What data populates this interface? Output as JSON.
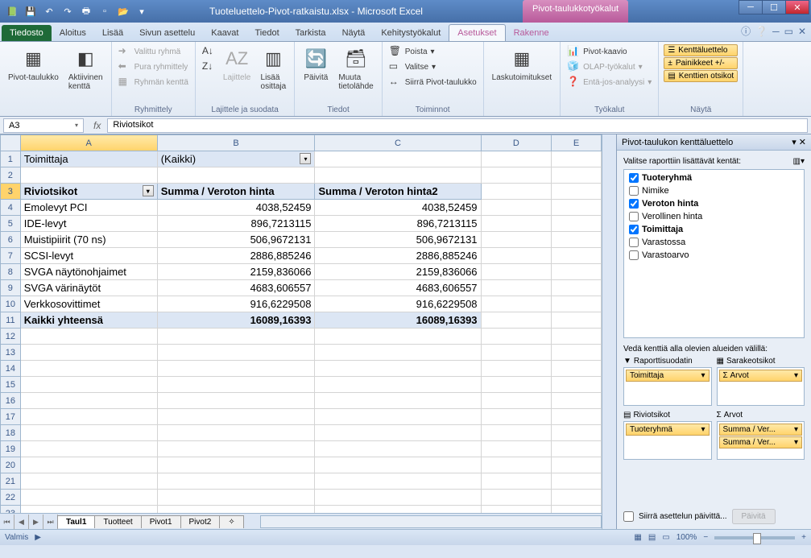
{
  "app": {
    "title": "Tuoteluettelo-Pivot-ratkaistu.xlsx - Microsoft Excel",
    "contextTools": "Pivot-taulukkotyökalut"
  },
  "tabs": {
    "file": "Tiedosto",
    "list": [
      "Aloitus",
      "Lisää",
      "Sivun asettelu",
      "Kaavat",
      "Tiedot",
      "Tarkista",
      "Näytä",
      "Kehitystyökalut"
    ],
    "pivot": [
      "Asetukset",
      "Rakenne"
    ],
    "activeIndex": 0
  },
  "ribbon": {
    "g1": {
      "btn1": "Pivot-taulukko",
      "btn2": "Aktiivinen\nkenttä"
    },
    "g2": {
      "label": "Ryhmittely",
      "i1": "Valittu ryhmä",
      "i2": "Pura ryhmittely",
      "i3": "Ryhmän kenttä"
    },
    "g3": {
      "label": "Lajittele ja suodata",
      "i1": "Lajittele",
      "i2": "Lisää\nosittaja"
    },
    "g4": {
      "label": "Tiedot",
      "i1": "Päivitä",
      "i2": "Muuta\ntietolähde"
    },
    "g5": {
      "label": "Toiminnot",
      "i1": "Poista",
      "i2": "Valitse",
      "i3": "Siirrä Pivot-taulukko"
    },
    "g6": {
      "i1": "Laskutoimitukset"
    },
    "g7": {
      "label": "Työkalut",
      "i1": "Pivot-kaavio",
      "i2": "OLAP-työkalut",
      "i3": "Entä-jos-analyysi"
    },
    "g8": {
      "label": "Näytä",
      "i1": "Kenttäluettelo",
      "i2": "Painikkeet +/-",
      "i3": "Kenttien otsikot"
    }
  },
  "formulaBar": {
    "nameBox": "A3",
    "formula": "Riviotsikot"
  },
  "grid": {
    "cols": [
      "A",
      "B",
      "C",
      "D",
      "E"
    ],
    "filterCell": {
      "label": "Toimittaja",
      "value": "(Kaikki)"
    },
    "headers": [
      "Riviotsikot",
      "Summa  / Veroton hinta",
      "Summa  / Veroton hinta2"
    ],
    "rows": [
      {
        "a": "Emolevyt PCI",
        "b": "4038,52459",
        "c": "4038,52459"
      },
      {
        "a": "IDE-levyt",
        "b": "896,7213115",
        "c": "896,7213115"
      },
      {
        "a": "Muistipiirit (70 ns)",
        "b": "506,9672131",
        "c": "506,9672131"
      },
      {
        "a": "SCSI-levyt",
        "b": "2886,885246",
        "c": "2886,885246"
      },
      {
        "a": "SVGA näytönohjaimet",
        "b": "2159,836066",
        "c": "2159,836066"
      },
      {
        "a": "SVGA värinäytöt",
        "b": "4683,606557",
        "c": "4683,606557"
      },
      {
        "a": "Verkkosovittimet",
        "b": "916,6229508",
        "c": "916,6229508"
      }
    ],
    "total": {
      "a": "Kaikki yhteensä",
      "b": "16089,16393",
      "c": "16089,16393"
    }
  },
  "sheets": {
    "active": "Taul1",
    "list": [
      "Taul1",
      "Tuotteet",
      "Pivot1",
      "Pivot2"
    ]
  },
  "fieldList": {
    "title": "Pivot-taulukon kenttäluettelo",
    "chooseLabel": "Valitse raporttiin lisättävät kentät:",
    "fields": [
      {
        "name": "Tuoteryhmä",
        "checked": true
      },
      {
        "name": "Nimike",
        "checked": false
      },
      {
        "name": "Veroton hinta",
        "checked": true
      },
      {
        "name": "Verollinen hinta",
        "checked": false
      },
      {
        "name": "Toimittaja",
        "checked": true
      },
      {
        "name": "Varastossa",
        "checked": false
      },
      {
        "name": "Varastoarvo",
        "checked": false
      }
    ],
    "dragLabel": "Vedä kenttiä alla olevien alueiden välillä:",
    "zones": {
      "filter": {
        "label": "Raporttisuodatin",
        "items": [
          "Toimittaja"
        ]
      },
      "cols": {
        "label": "Sarakeotsikot",
        "items": [
          "Σ Arvot"
        ]
      },
      "rows": {
        "label": "Riviotsikot",
        "items": [
          "Tuoteryhmä"
        ]
      },
      "vals": {
        "label": "Arvot",
        "items": [
          "Summa  / Ver...",
          "Summa  / Ver..."
        ]
      }
    },
    "defer": "Siirrä asettelun päivittä...",
    "updateBtn": "Päivitä"
  },
  "statusbar": {
    "ready": "Valmis",
    "zoom": "100%"
  }
}
